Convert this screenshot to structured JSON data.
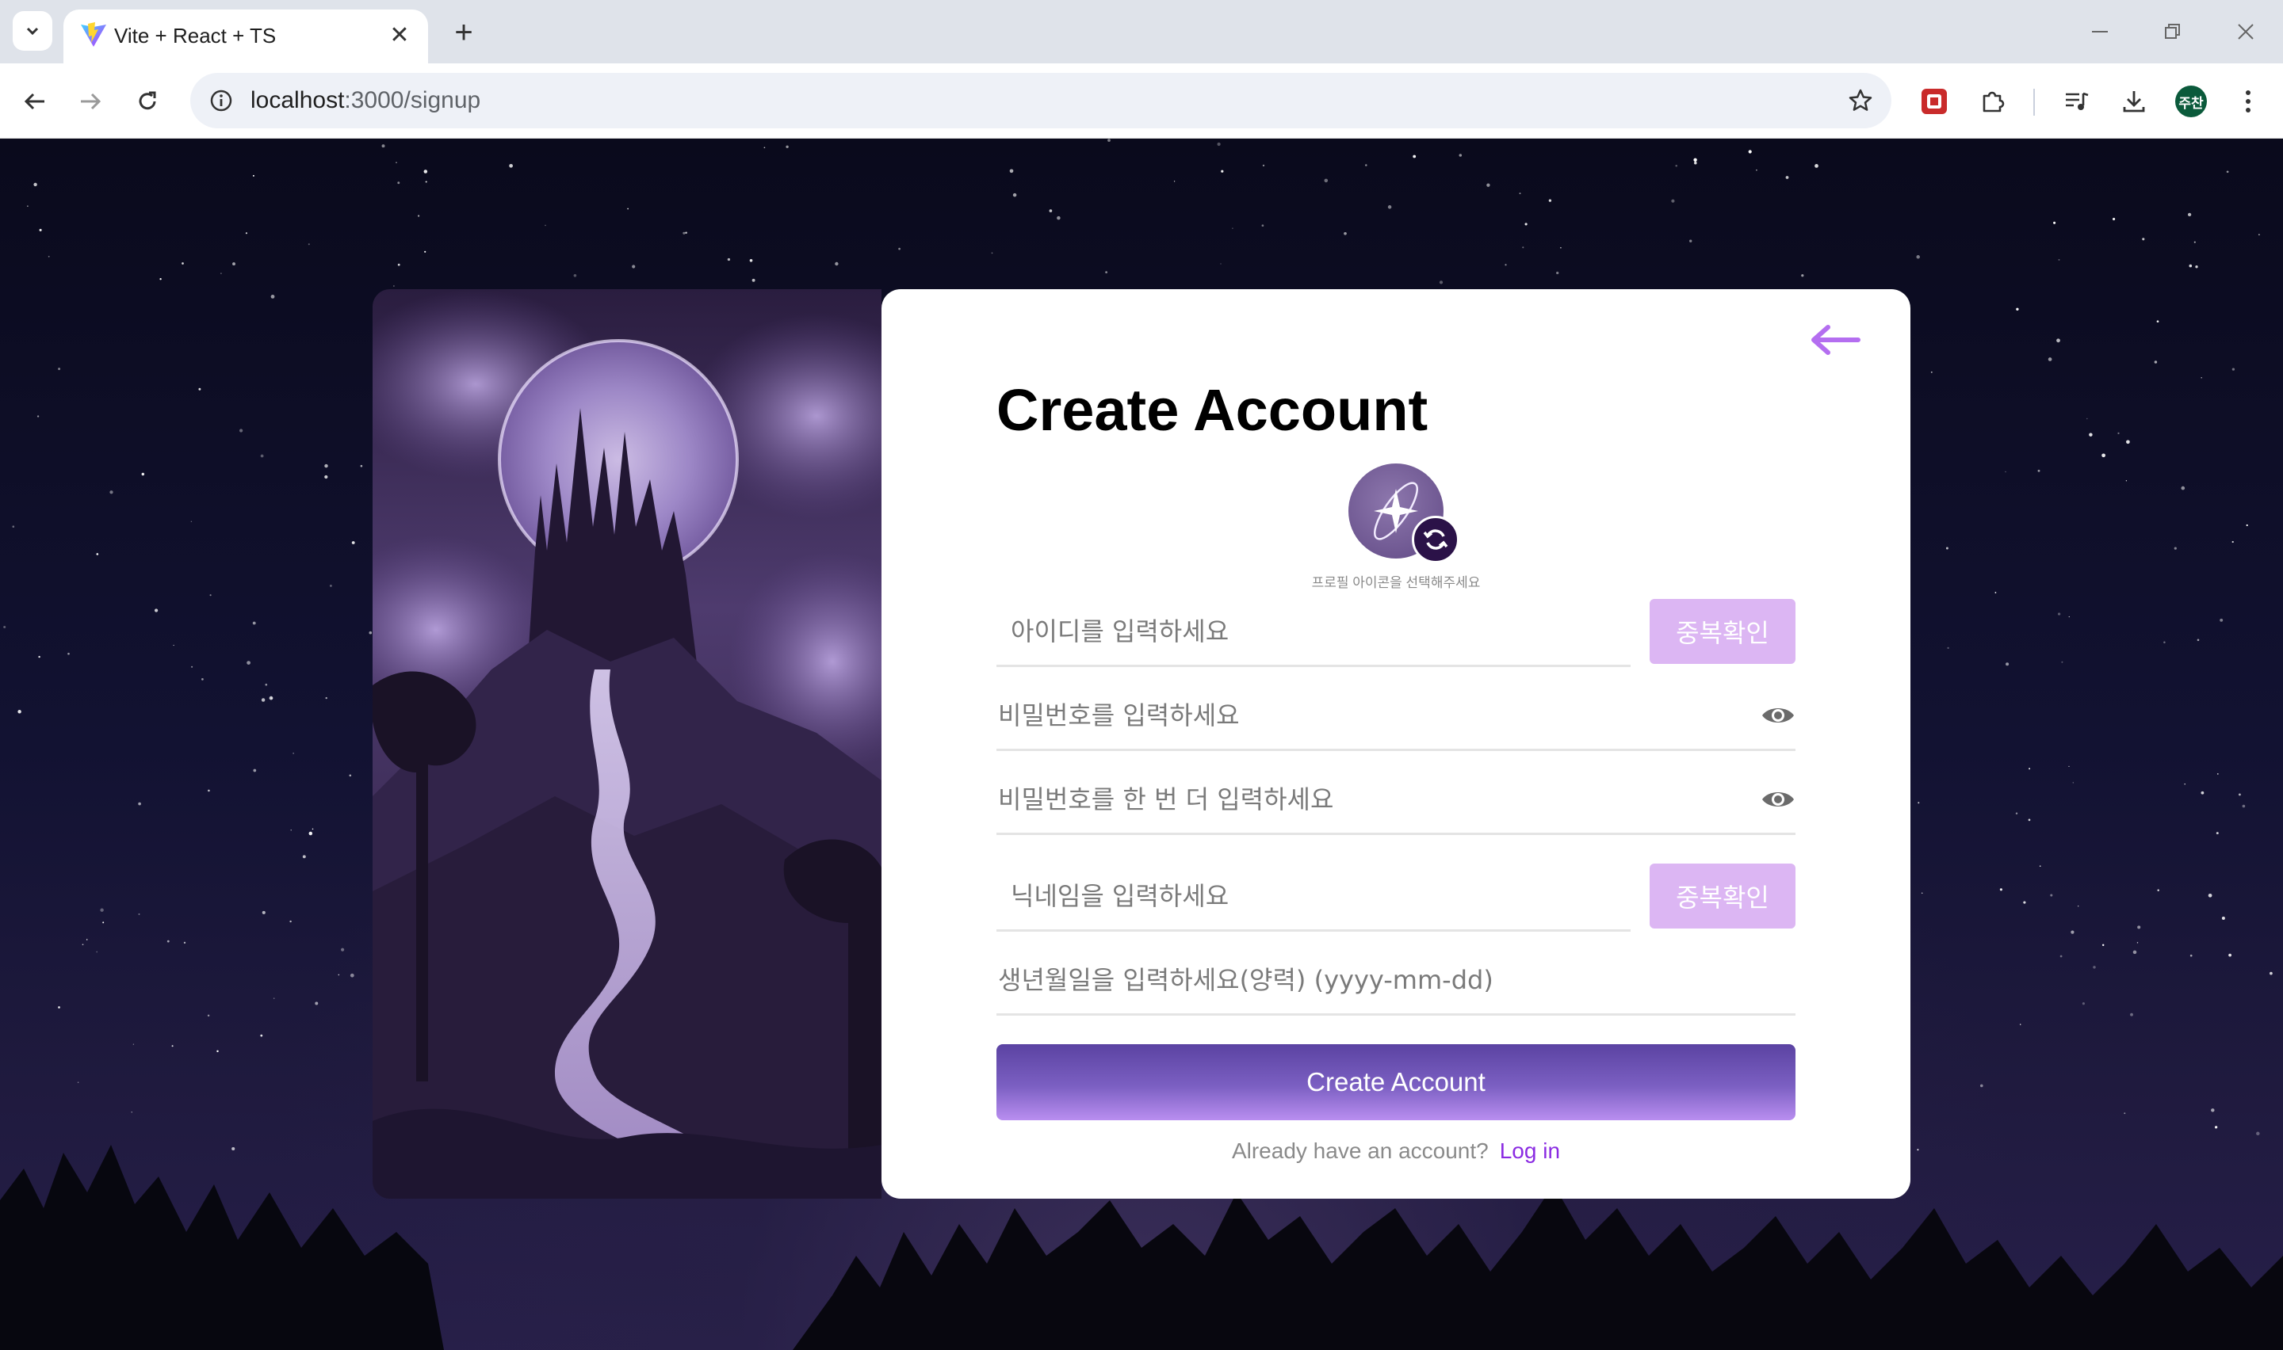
{
  "browser": {
    "tab_title": "Vite + React + TS",
    "url_host": "localhost",
    "url_rest": ":3000/signup",
    "profile_initials": "주찬"
  },
  "icons": {
    "tab_menu": "chevron-down-icon",
    "favicon": "vite-logo-icon",
    "tab_close": "close-icon",
    "new_tab": "plus-icon",
    "back": "arrow-left-icon",
    "forward": "arrow-right-icon",
    "reload": "reload-icon",
    "site_info": "info-icon",
    "bookmark": "star-icon",
    "extension": "extension-app-icon",
    "extensions": "puzzle-icon",
    "media": "media-queue-icon",
    "download": "download-icon",
    "menu": "kebab-menu-icon",
    "eye": "eye-icon",
    "refresh": "refresh-icon"
  },
  "signup": {
    "title": "Create Account",
    "avatar_hint": "프로필 아이콘을 선택해주세요",
    "id_placeholder": "아이디를 입력하세요",
    "dup_check_label": "중복확인",
    "password_placeholder": "비밀번호를 입력하세요",
    "password_confirm_placeholder": "비밀번호를 한 번 더 입력하세요",
    "nickname_placeholder": "닉네임을 입력하세요",
    "birth_placeholder": "생년월일을 입력하세요(양력) (yyyy-mm-dd)",
    "submit_label": "Create Account",
    "login_prompt": "Already have an account?",
    "login_link": "Log in"
  },
  "colors": {
    "accent": "#8a2be2",
    "dup_button": "#dcb6f3",
    "back_arrow": "#b46ef0",
    "submit_top": "#5b43a2",
    "submit_bottom": "#b98ef0"
  }
}
